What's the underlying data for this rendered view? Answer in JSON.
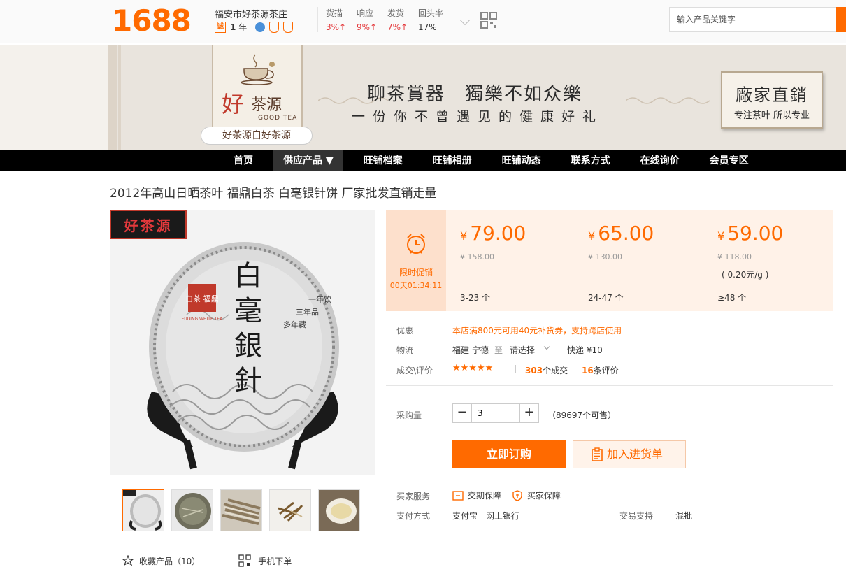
{
  "header": {
    "logo": "1688",
    "shop_name": "福安市好茶源茶庄",
    "badge_cheng": "诚",
    "years_num": "1",
    "years_unit": "年",
    "stats": [
      {
        "label": "货描",
        "value": "3%↑"
      },
      {
        "label": "响应",
        "value": "9%↑"
      },
      {
        "label": "发货",
        "value": "7%↑"
      },
      {
        "label": "回头率",
        "value": "17%"
      }
    ],
    "search_placeholder": "输入产品关键字"
  },
  "banner": {
    "logo_hao": "好",
    "logo_chayuan": "茶源",
    "logo_en": "GOOD TEA",
    "slogan_pill": "好茶源自好茶源",
    "line1": "聊茶賞器　獨樂不如众樂",
    "line2": "一份你不曾遇见的健康好礼",
    "stamp_title": "廠家直銷",
    "stamp_sub": "专注茶叶 所以专业"
  },
  "nav": {
    "items": [
      {
        "label": "首页"
      },
      {
        "label": "供应产品 ▼"
      },
      {
        "label": "旺铺档案"
      },
      {
        "label": "旺铺相册"
      },
      {
        "label": "旺铺动态"
      },
      {
        "label": "联系方式"
      },
      {
        "label": "在线询价"
      },
      {
        "label": "会员专区"
      }
    ]
  },
  "product": {
    "title": "2012年高山日晒茶叶 福鼎白茶 白毫银针饼 厂家批发直销走量",
    "image": {
      "brand_tag": "好茶源",
      "cake_title": "白毫銀針",
      "cake_side": "一年饮 三年品 多年藏",
      "cake_logo": "白茶 福鼎",
      "cake_logo_en": "FUDING WHITE TEA"
    },
    "favorites_label": "收藏产品（10）",
    "mobile_label": "手机下单"
  },
  "price": {
    "promo_label": "限时促销",
    "promo_timer": "00天01:34:11",
    "tiers": [
      {
        "price": "79.00",
        "old": "¥ 158.00",
        "unit": "",
        "qty": "3-23 个"
      },
      {
        "price": "65.00",
        "old": "¥ 130.00",
        "unit": "",
        "qty": "24-47 个"
      },
      {
        "price": "59.00",
        "old": "¥ 118.00",
        "unit": "( 0.20元/g )",
        "qty": "≥48 个"
      }
    ],
    "yen": "¥"
  },
  "info": {
    "discount_label": "优惠",
    "discount_text": "本店满800元可用40元补货券，支持跨店使用",
    "logistics_label": "物流",
    "origin": "福建 宁德",
    "to": "至",
    "select": "请选择",
    "express": "快递 ¥10",
    "deal_label": "成交\\评价",
    "stars": "★★★★★",
    "deals_num": "303",
    "deals_text": "个成交",
    "reviews_num": "16",
    "reviews_text": "条评价",
    "qty_label": "采购量",
    "qty_value": "3",
    "stock": "（89697个可售）",
    "buy_now": "立即订购",
    "add_cart": "加入进货单",
    "service_label": "买家服务",
    "service1": "交期保障",
    "service2": "买家保障",
    "pay_label": "支付方式",
    "pay_methods": "支付宝　网上银行",
    "trade_label": "交易支持",
    "trade_value": "混批"
  }
}
